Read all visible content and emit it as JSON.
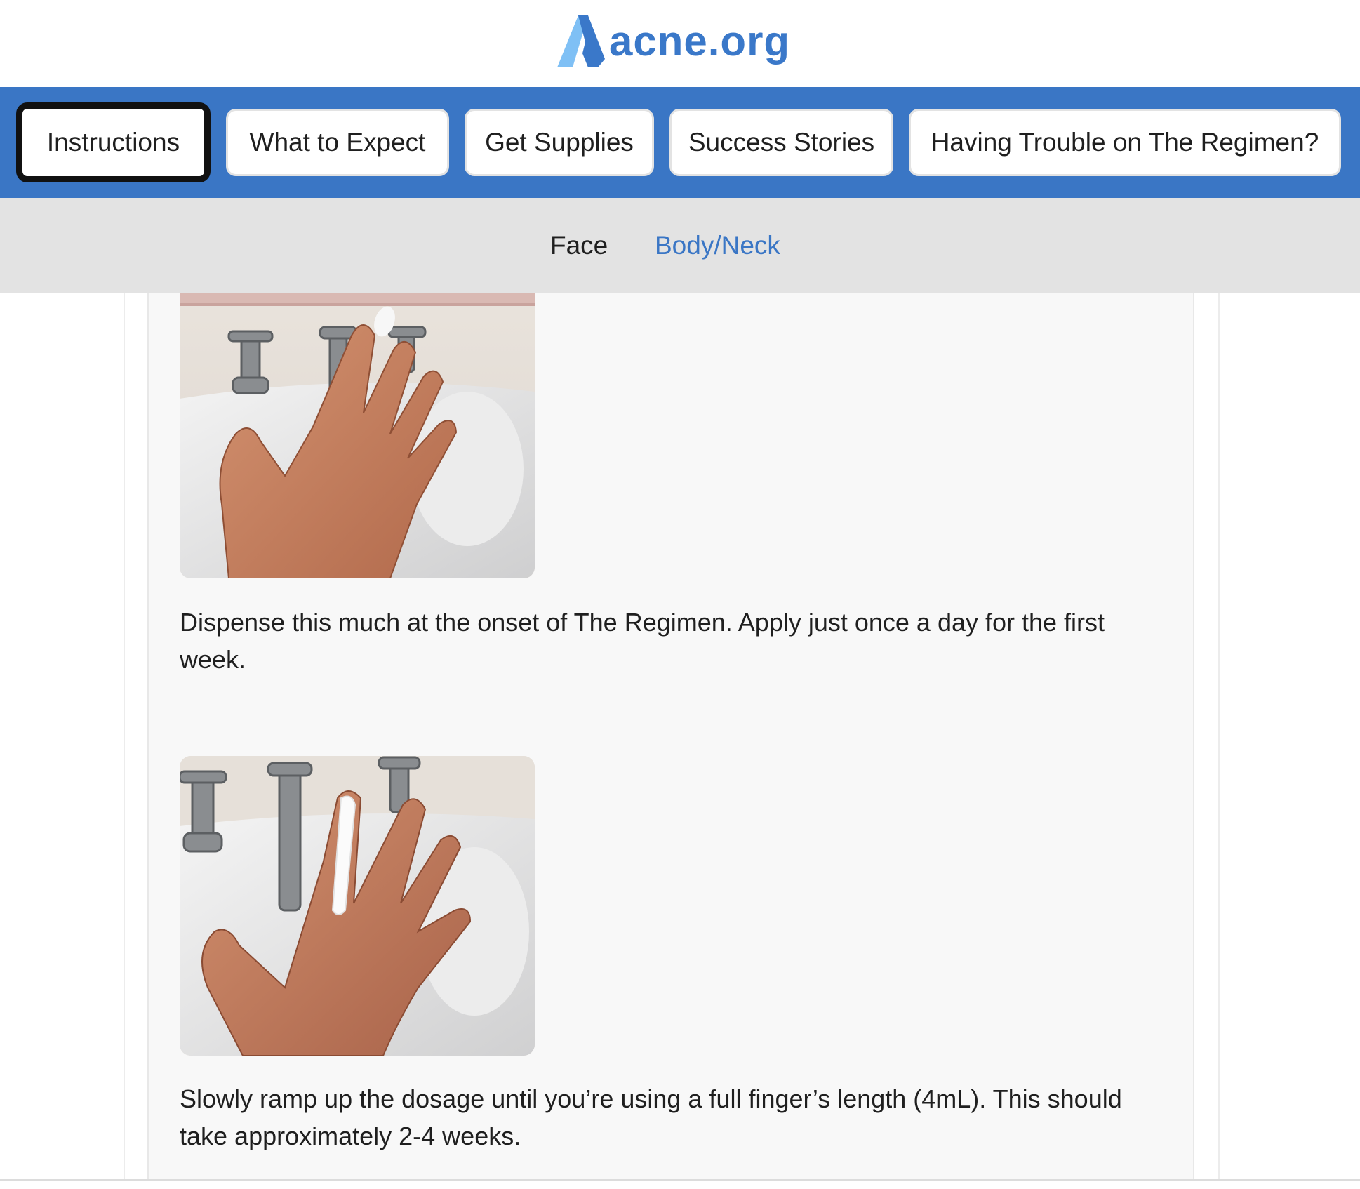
{
  "logo": {
    "text": "acne.org",
    "color": "#3a78c9",
    "accent_light": "#7fc0f5"
  },
  "primary_nav": {
    "background": "#3a76c5",
    "items": [
      {
        "label": "Instructions",
        "active": true
      },
      {
        "label": "What to Expect",
        "active": false
      },
      {
        "label": "Get Supplies",
        "active": false
      },
      {
        "label": "Success Stories",
        "active": false
      },
      {
        "label": "Having Trouble on The Regimen?",
        "active": false
      }
    ]
  },
  "sub_nav": {
    "current": "Face",
    "other": "Body/Neck",
    "link_color": "#3a76c5"
  },
  "steps": [
    {
      "image_icon": "hand-with-small-dot-photo",
      "caption": "Dispense this much at the onset of The Regimen. Apply just once a day for the first week."
    },
    {
      "image_icon": "hand-with-full-finger-photo",
      "caption": "Slowly ramp up the dosage until you’re using a full finger’s length (4mL). This should take approximately 2-4 weeks."
    }
  ]
}
